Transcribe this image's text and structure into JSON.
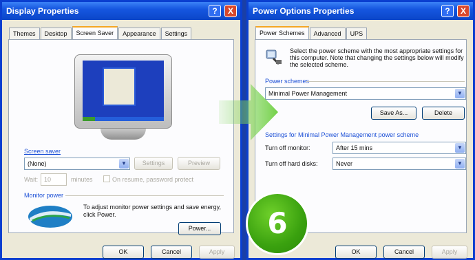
{
  "display": {
    "title": "Display Properties",
    "help": "?",
    "close": "X",
    "tabs": [
      "Themes",
      "Desktop",
      "Screen Saver",
      "Appearance",
      "Settings"
    ],
    "screen_saver_label": "Screen saver",
    "screen_saver_value": "(None)",
    "settings_button": "Settings",
    "preview_button": "Preview",
    "wait_label": "Wait:",
    "wait_value": "10",
    "minutes_label": "minutes",
    "on_resume_label": "On resume, password protect",
    "monitor_power_label": "Monitor power",
    "monitor_power_text": "To adjust monitor power settings and save energy, click Power.",
    "power_button": "Power...",
    "ok": "OK",
    "cancel": "Cancel",
    "apply": "Apply"
  },
  "power": {
    "title": "Power Options Properties",
    "help": "?",
    "close": "X",
    "tabs": [
      "Power Schemes",
      "Advanced",
      "UPS"
    ],
    "description": "Select the power scheme with the most appropriate settings for this computer. Note that changing the settings below will modify the selected scheme.",
    "schemes_label": "Power schemes",
    "scheme_value": "Minimal Power Management",
    "save_as": "Save As...",
    "delete": "Delete",
    "settings_for_label": "Settings for Minimal Power Management power scheme",
    "turn_off_monitor_label": "Turn off monitor:",
    "turn_off_monitor_value": "After 15 mins",
    "turn_off_disks_label": "Turn off hard disks:",
    "turn_off_disks_value": "Never",
    "ok": "OK",
    "cancel": "Cancel",
    "apply": "Apply"
  },
  "badge": "6",
  "colors": {
    "titlebar": "#0b46c8",
    "close_button": "#d8482c",
    "arrow": "#8bd86a",
    "badge": "#3aa10f",
    "link_label": "#1b4fd6"
  },
  "icons": [
    "monitor-preview-icon",
    "energy-star-logo",
    "power-plug-icon",
    "right-arrow-icon",
    "step-six-badge"
  ]
}
